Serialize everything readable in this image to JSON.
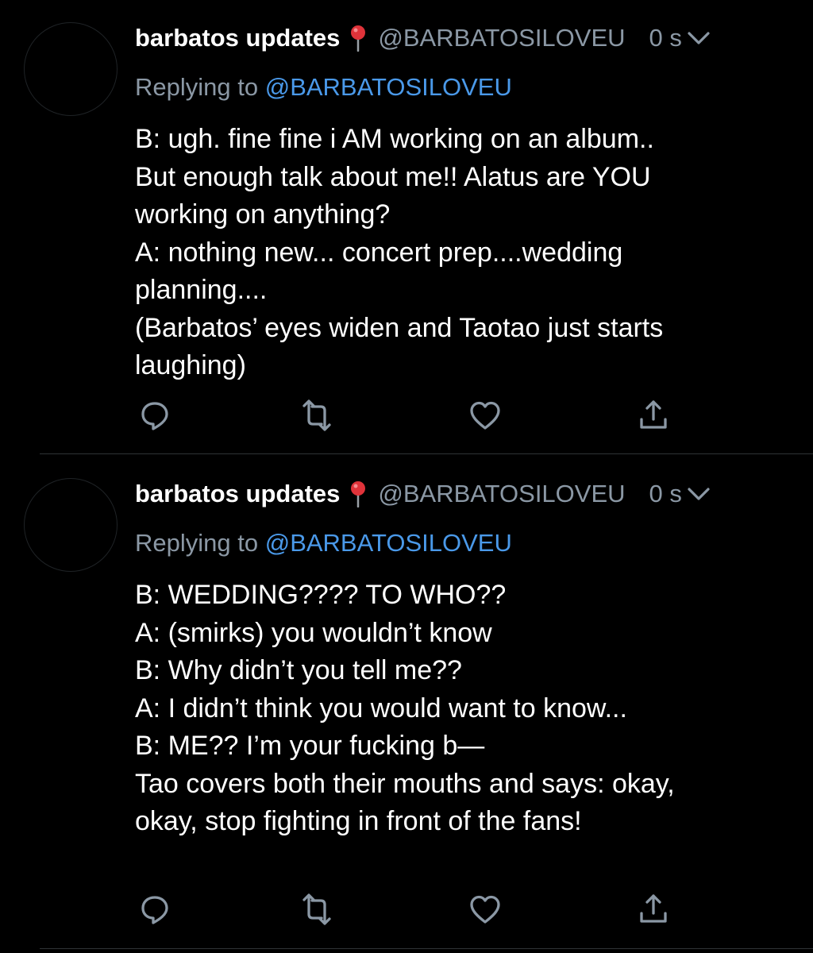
{
  "tweets": [
    {
      "display_name": "barbatos updates",
      "handle": "@BARBATOSILOVEU",
      "time": "0 s",
      "reply_prefix": "Replying to ",
      "reply_handle": "@BARBATOSILOVEU",
      "lines": [
        "B: ugh. fine fine i AM working on an album..",
        "But enough talk about me!! Alatus are YOU",
        "working on anything?",
        "A: nothing new... concert prep....wedding",
        "planning....",
        "(Barbatos’ eyes widen and Taotao just starts",
        "laughing)"
      ]
    },
    {
      "display_name": "barbatos updates",
      "handle": "@BARBATOSILOVEU",
      "time": "0 s",
      "reply_prefix": "Replying to ",
      "reply_handle": "@BARBATOSILOVEU",
      "lines": [
        "B: WEDDING???? TO WHO??",
        "A: (smirks) you wouldn’t know",
        "B: Why didn’t you tell me??",
        "A: I didn’t think you would want to know...",
        "B: ME?? I’m your fucking b—",
        "Tao covers both their mouths and says: okay,",
        "okay, stop fighting in front of the fans!"
      ]
    }
  ],
  "icons": {
    "location": "round-pushpin-icon",
    "menu": "chevron-down-icon",
    "reply": "reply-icon",
    "retweet": "retweet-icon",
    "like": "heart-icon",
    "share": "share-icon"
  },
  "colors": {
    "background": "#000000",
    "text": "#ffffff",
    "secondary": "#8b98a5",
    "link": "#4a99e9",
    "pin": "#e0333a",
    "divider": "#2f3336"
  }
}
